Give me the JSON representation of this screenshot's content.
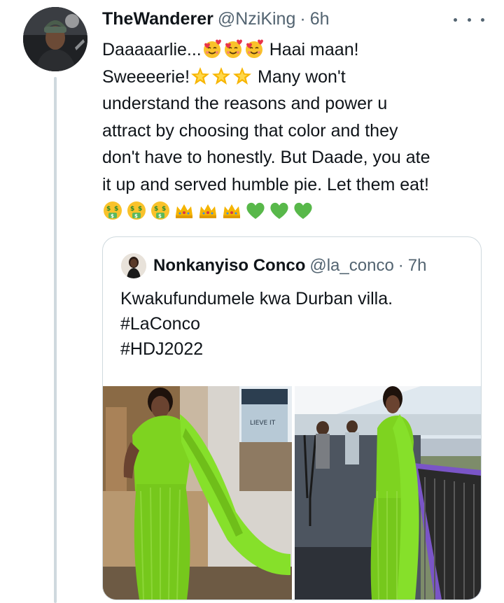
{
  "tweet": {
    "author": {
      "name": "TheWanderer",
      "handle": "@NziKing",
      "separator": "·",
      "time": "6h"
    },
    "text": {
      "l1_a": "Daaaaarlie...",
      "l1_b": " Haai maan!",
      "l2_a": "Sweeeerie!",
      "l2_b": " Many won't",
      "l3": "understand the reasons and power u",
      "l4": "attract by choosing that color and they",
      "l5": "don't have to honestly. But Daade, you ate",
      "l6": "it up and served humble pie. Let them eat!"
    },
    "emoji": {
      "line1": [
        "smiling-face-with-hearts",
        "smiling-face-with-hearts",
        "smiling-face-with-hearts"
      ],
      "line2": [
        "glowing-star",
        "glowing-star",
        "glowing-star"
      ],
      "line7": [
        "money-mouth-face",
        "money-mouth-face",
        "money-mouth-face",
        "crown",
        "crown",
        "crown",
        "green-heart",
        "green-heart",
        "green-heart"
      ]
    },
    "colors": {
      "text": "#0f1419",
      "secondary": "#536471",
      "border": "#cfd9de",
      "dress_green": "#7ed320"
    }
  },
  "quote": {
    "author": {
      "name": "Nonkanyiso Conco",
      "handle": "@la_conco",
      "separator": "·",
      "time": "7h"
    },
    "lines": [
      "Kwakufundumele kwa Durban villa.",
      "#LaConco",
      "#HDJ2022"
    ],
    "photo_sign_text": "LIEVE IT"
  }
}
